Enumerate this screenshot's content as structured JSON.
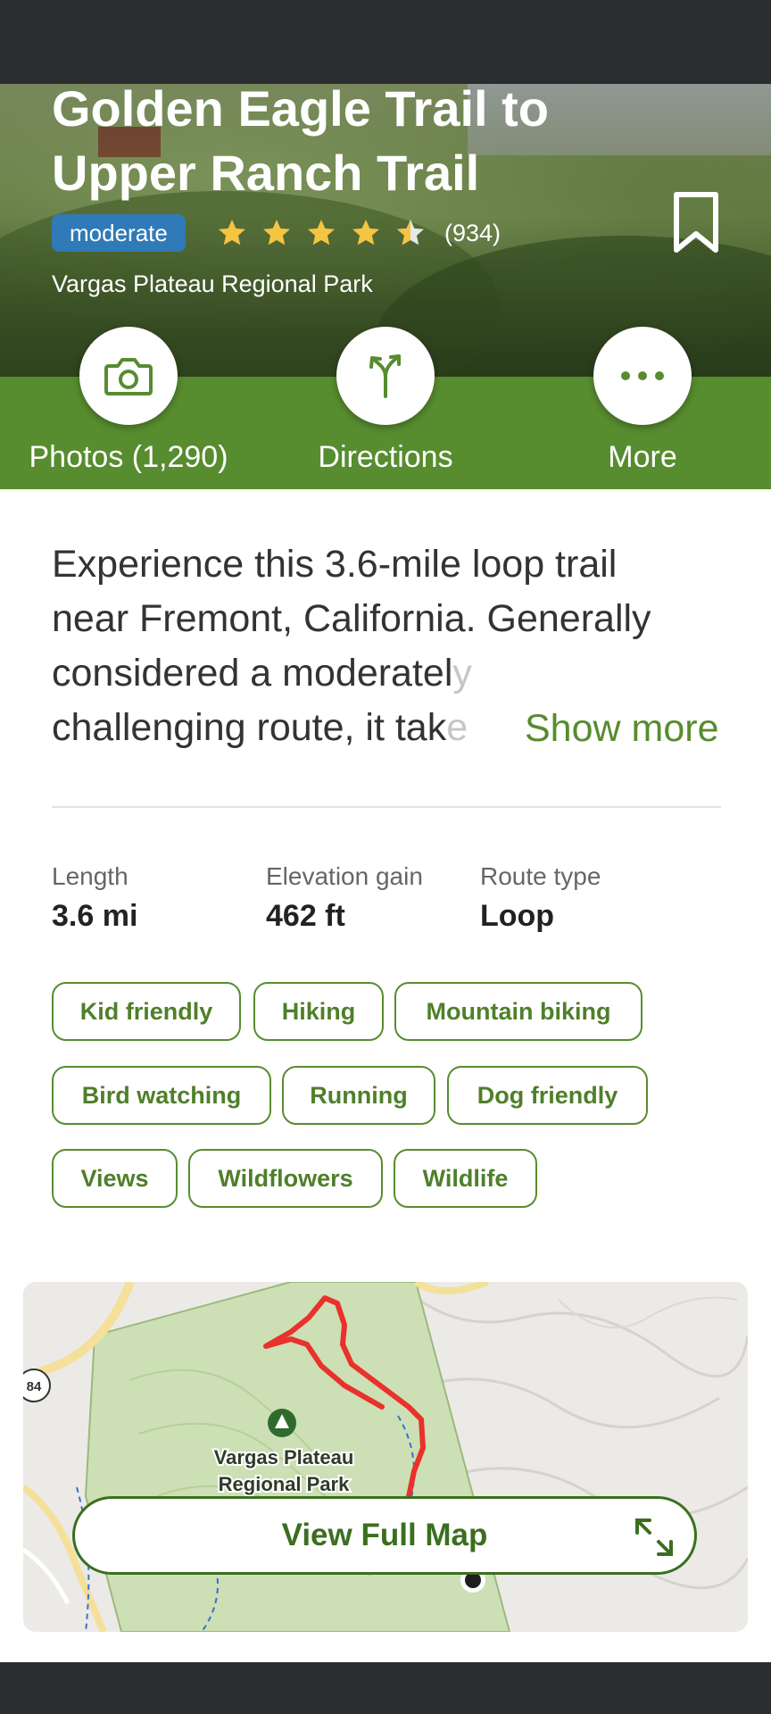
{
  "trail": {
    "title": "Golden Eagle Trail to Upper Ranch Trail",
    "difficulty": "moderate",
    "rating": 4.5,
    "reviews": "(934)",
    "park": "Vargas Plateau Regional Park"
  },
  "icons": {
    "bookmark": "bookmark-icon",
    "photos": "camera-icon",
    "directions": "directions-arrows-icon",
    "more": "ellipsis-icon",
    "expand": "expand-icon"
  },
  "actions": {
    "photos_label": "Photos (1,290)",
    "directions_label": "Directions",
    "more_label": "More"
  },
  "description": {
    "line1": "Experience this 3.6-mile loop trail",
    "line2": "near Fremont, California. Generally",
    "line3_a": "considered a moderatel",
    "line3_b": "y",
    "line4_a": "challenging route, it tak",
    "line4_b": "e",
    "show_more": "Show more"
  },
  "stats": [
    {
      "label": "Length",
      "value": "3.6 mi"
    },
    {
      "label": "Elevation gain",
      "value": "462 ft"
    },
    {
      "label": "Route type",
      "value": "Loop"
    }
  ],
  "tags": [
    "Kid friendly",
    "Hiking",
    "Mountain biking",
    "Bird watching",
    "Running",
    "Dog friendly",
    "Views",
    "Wildflowers",
    "Wildlife"
  ],
  "map": {
    "park_label_line1": "Vargas Plateau",
    "park_label_line2": "Regional Park",
    "road_shield": "84",
    "button_label": "View Full Map"
  },
  "colors": {
    "brand_green": "#578c2f",
    "badge_blue": "#2f7ab7",
    "star_gold": "#f5c542",
    "trail_red": "#e8322b"
  }
}
